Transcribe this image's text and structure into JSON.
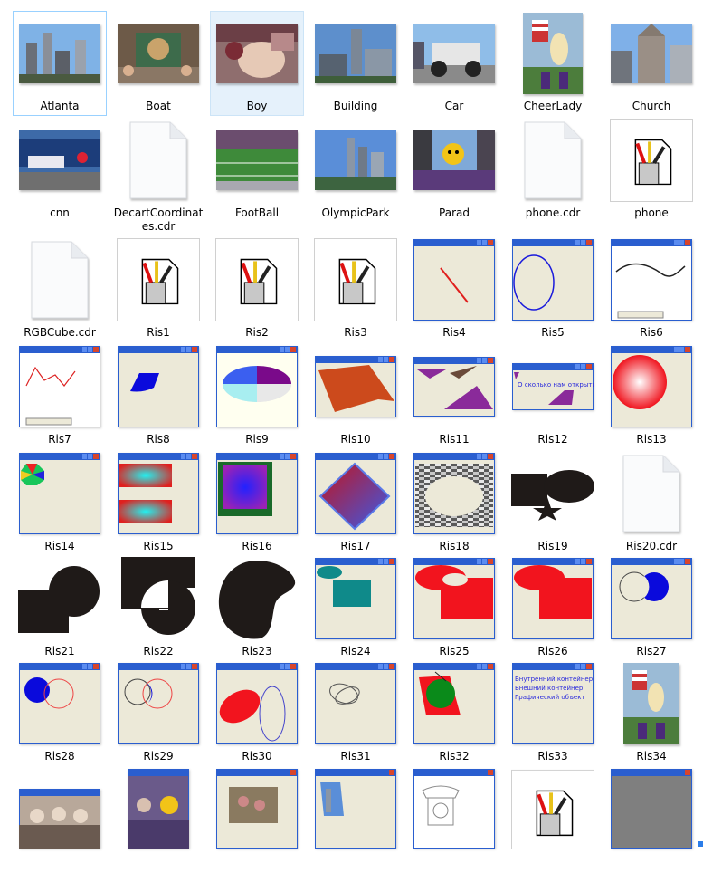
{
  "window": {
    "title": "Explorer file view"
  },
  "items": [
    {
      "name": "Atlanta",
      "type": "photo"
    },
    {
      "name": "Boat",
      "type": "photo"
    },
    {
      "name": "Boy",
      "type": "photo"
    },
    {
      "name": "Building",
      "type": "photo"
    },
    {
      "name": "Car",
      "type": "photo"
    },
    {
      "name": "CheerLady",
      "type": "photo"
    },
    {
      "name": "Church",
      "type": "photo"
    },
    {
      "name": "cnn",
      "type": "photo"
    },
    {
      "name": "DecartCoordinates.cdr",
      "type": "file"
    },
    {
      "name": "FootBall",
      "type": "photo"
    },
    {
      "name": "OlympicPark",
      "type": "photo"
    },
    {
      "name": "Parad",
      "type": "photo"
    },
    {
      "name": "phone.cdr",
      "type": "file"
    },
    {
      "name": "phone",
      "type": "app"
    },
    {
      "name": "RGBCube.cdr",
      "type": "file"
    },
    {
      "name": "Ris1",
      "type": "app"
    },
    {
      "name": "Ris2",
      "type": "app"
    },
    {
      "name": "Ris3",
      "type": "app"
    },
    {
      "name": "Ris4",
      "type": "window"
    },
    {
      "name": "Ris5",
      "type": "window"
    },
    {
      "name": "Ris6",
      "type": "window"
    },
    {
      "name": "Ris7",
      "type": "window"
    },
    {
      "name": "Ris8",
      "type": "window"
    },
    {
      "name": "Ris9",
      "type": "window"
    },
    {
      "name": "Ris10",
      "type": "window"
    },
    {
      "name": "Ris11",
      "type": "window"
    },
    {
      "name": "Ris12",
      "type": "window"
    },
    {
      "name": "Ris13",
      "type": "window"
    },
    {
      "name": "Ris14",
      "type": "window"
    },
    {
      "name": "Ris15",
      "type": "window"
    },
    {
      "name": "Ris16",
      "type": "window"
    },
    {
      "name": "Ris17",
      "type": "window"
    },
    {
      "name": "Ris18",
      "type": "window"
    },
    {
      "name": "Ris19",
      "type": "shape"
    },
    {
      "name": "Ris20.cdr",
      "type": "file"
    },
    {
      "name": "Ris21",
      "type": "shape"
    },
    {
      "name": "Ris22",
      "type": "shape"
    },
    {
      "name": "Ris23",
      "type": "shape"
    },
    {
      "name": "Ris24",
      "type": "window"
    },
    {
      "name": "Ris25",
      "type": "window"
    },
    {
      "name": "Ris26",
      "type": "window"
    },
    {
      "name": "Ris27",
      "type": "window"
    },
    {
      "name": "Ris28",
      "type": "window"
    },
    {
      "name": "Ris29",
      "type": "window"
    },
    {
      "name": "Ris30",
      "type": "window"
    },
    {
      "name": "Ris31",
      "type": "window"
    },
    {
      "name": "Ris32",
      "type": "window"
    },
    {
      "name": "Ris33",
      "type": "window"
    },
    {
      "name": "Ris34",
      "type": "photo"
    },
    {
      "name": "",
      "type": "window"
    },
    {
      "name": "",
      "type": "photo"
    },
    {
      "name": "",
      "type": "window"
    },
    {
      "name": "",
      "type": "window"
    },
    {
      "name": "",
      "type": "window"
    },
    {
      "name": "",
      "type": "app"
    },
    {
      "name": "",
      "type": "window"
    }
  ],
  "ris12_text": "О сколько нам открытий...",
  "ris33_lines": [
    "Внутренний контейнер",
    "Внешний контейнер",
    "Графический объект"
  ],
  "colors": {
    "selection": "#e5f1fb",
    "hover_border": "#99d1ff",
    "xp_title": "#2a5ecf",
    "xp_body": "#ece9d8"
  }
}
